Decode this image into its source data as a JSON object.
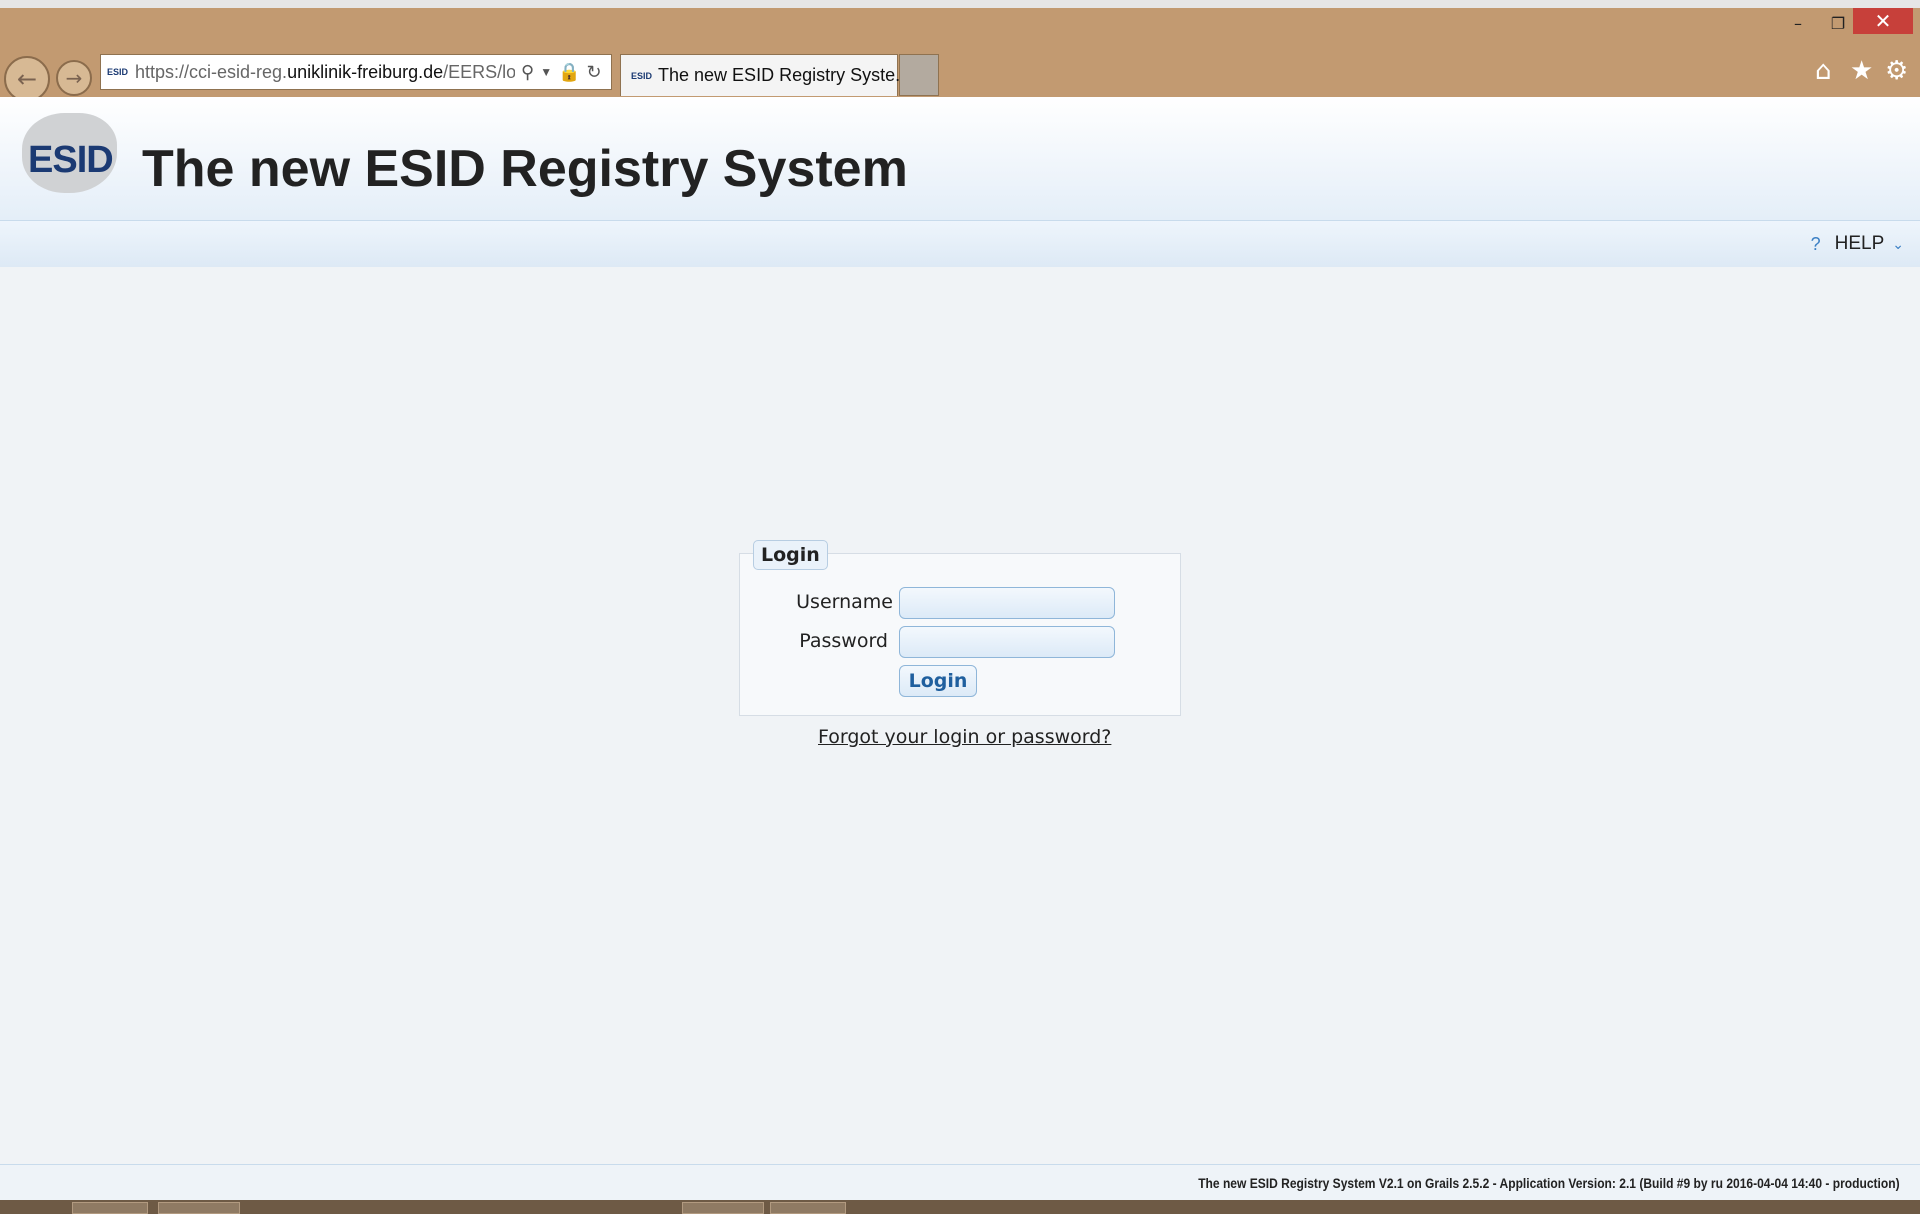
{
  "window": {
    "minimize_icon": "minimize-icon",
    "maximize_icon": "restore-icon",
    "close_icon": "close-icon"
  },
  "browser": {
    "url_scheme": "https://cci-esid-reg.",
    "url_host": "uniklinik-freiburg.de",
    "url_path": "/EERS/logi",
    "tab_title": "The new ESID Registry Syste...",
    "favicon_text": "ESID",
    "colors": {
      "frame": "#c29a71",
      "close": "#c7403a"
    }
  },
  "header": {
    "logo_text": "ESID",
    "title": "The new ESID Registry System"
  },
  "menu": {
    "help_label": "HELP"
  },
  "login": {
    "legend": "Login",
    "username_label": "Username",
    "username_value": "",
    "password_label": "Password",
    "password_value": "",
    "submit_label": "Login",
    "forgot_link": "Forgot your login or password?"
  },
  "footer": {
    "text": "The new ESID Registry System V2.1 on Grails 2.5.2 - Application Version: 2.1 (Build #9 by ru 2016-04-04 14:40 - production)"
  }
}
